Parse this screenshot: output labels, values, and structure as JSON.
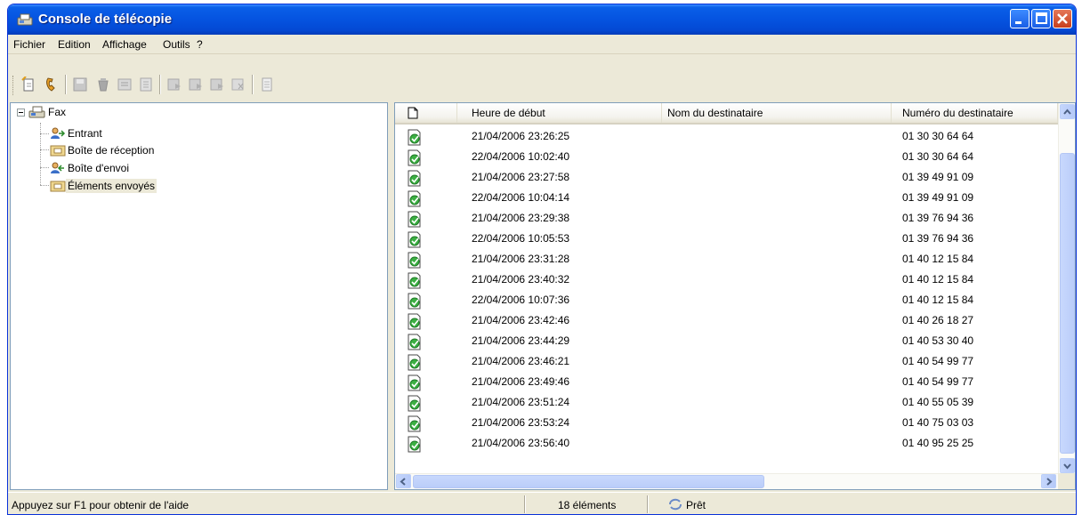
{
  "window": {
    "title": "Console de télécopie"
  },
  "menu": [
    "Fichier",
    "Edition",
    "Affichage",
    "Outils",
    "?"
  ],
  "tree": {
    "root": "Fax",
    "children": [
      "Entrant",
      "Boîte de réception",
      "Boîte d'envoi",
      "Éléments envoyés"
    ],
    "selected": "Éléments envoyés"
  },
  "list": {
    "columns": [
      "Heure de début",
      "Nom du destinataire",
      "Numéro du destinataire"
    ],
    "rows": [
      {
        "time": "21/04/2006 23:26:25",
        "name": "",
        "number": "01 30 30 64 64"
      },
      {
        "time": "22/04/2006 10:02:40",
        "name": "",
        "number": "01 30 30 64 64"
      },
      {
        "time": "21/04/2006 23:27:58",
        "name": "",
        "number": "01 39 49 91 09"
      },
      {
        "time": "22/04/2006 10:04:14",
        "name": "",
        "number": "01 39 49 91 09"
      },
      {
        "time": "21/04/2006 23:29:38",
        "name": "",
        "number": "01 39 76 94 36"
      },
      {
        "time": "22/04/2006 10:05:53",
        "name": "",
        "number": "01 39 76 94 36"
      },
      {
        "time": "21/04/2006 23:31:28",
        "name": "",
        "number": "01 40 12 15 84"
      },
      {
        "time": "21/04/2006 23:40:32",
        "name": "",
        "number": "01 40 12 15 84"
      },
      {
        "time": "22/04/2006 10:07:36",
        "name": "",
        "number": "01 40 12 15 84"
      },
      {
        "time": "21/04/2006 23:42:46",
        "name": "",
        "number": "01 40 26 18 27"
      },
      {
        "time": "21/04/2006 23:44:29",
        "name": "",
        "number": "01 40 53 30 40"
      },
      {
        "time": "21/04/2006 23:46:21",
        "name": "",
        "number": "01 40 54 99 77"
      },
      {
        "time": "21/04/2006 23:49:46",
        "name": "",
        "number": "01 40 54 99 77"
      },
      {
        "time": "21/04/2006 23:51:24",
        "name": "",
        "number": "01 40 55 05 39"
      },
      {
        "time": "21/04/2006 23:53:24",
        "name": "",
        "number": "01 40 75 03 03"
      },
      {
        "time": "21/04/2006 23:56:40",
        "name": "",
        "number": "01 40 95 25 25"
      }
    ]
  },
  "status": {
    "help": "Appuyez sur F1 pour obtenir de l'aide",
    "count": "18 éléments",
    "state": "Prêt"
  },
  "colors": {
    "titlebar": "#0553e0",
    "window_bg": "#ece9d8",
    "selection": "#ece9d8",
    "fax_icon_green": "#3cb043"
  },
  "icons": {
    "title": "fax-console-icon",
    "row": "sent-fax-icon",
    "header": "document-icon",
    "status": "ready-icon"
  }
}
